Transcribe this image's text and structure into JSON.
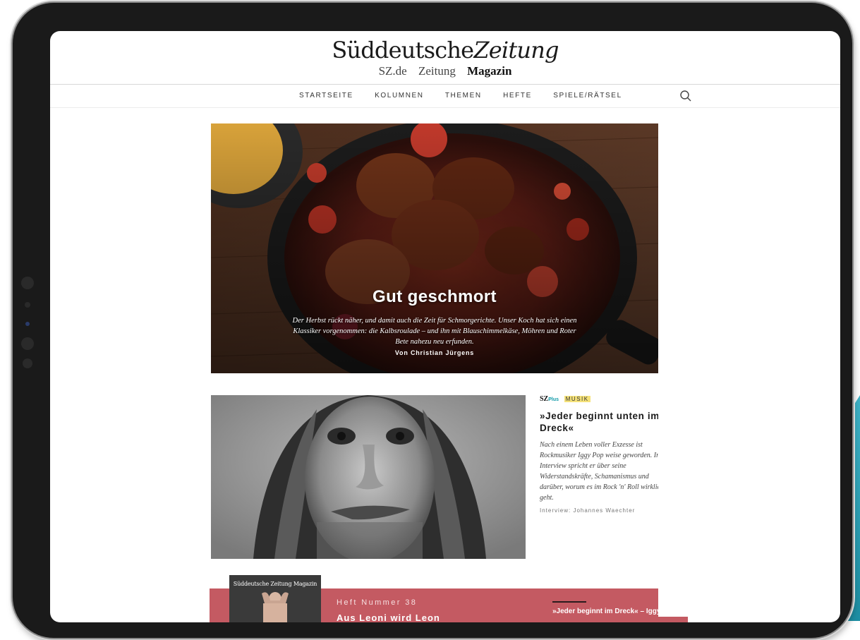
{
  "masthead": {
    "logo_part1": "Süddeutsche",
    "logo_part2": "Zeitung",
    "subnav": [
      "SZ.de",
      "Zeitung",
      "Magazin"
    ]
  },
  "mainnav": {
    "items": [
      "STARTSEITE",
      "KOLUMNEN",
      "THEMEN",
      "HEFTE",
      "SPIELE/RÄTSEL"
    ],
    "search_icon": "search-icon"
  },
  "hero": {
    "title": "Gut geschmort",
    "description": "Der Herbst rückt näher, und damit auch die Zeit für Schmorgerichte. Unser Koch hat sich einen Klassiker vorgenommen: die Kalbsroulade – und ihn mit Blauschimmelkäse, Möhren und Roter Bete nahezu neu erfunden.",
    "author": "Von Christian Jürgens"
  },
  "article2": {
    "badge_sz": "SZ",
    "badge_plus": "Plus",
    "category": "MUSIK",
    "title": "»Jeder beginnt unten im Dreck«",
    "body": "Nach einem Leben voller Exzesse ist Rockmusiker Iggy Pop weise geworden. Im Interview spricht er über seine Widerstandskräfte, Schamanismus und darüber, worum es im Rock 'n' Roll wirklich geht.",
    "author": "Interview: Johannes Waechter"
  },
  "heft": {
    "cover_title": "Süddeutsche Zeitung Magazin",
    "label": "Heft Nummer 38",
    "title": "Aus Leoni wird Leon",
    "quote": "»Jeder beginnt im Dreck« – Iggy Pop spricht im"
  },
  "colors": {
    "band": "#c45a62",
    "accent_plus": "#0f9aa8",
    "category_highlight": "#f5e27a"
  }
}
